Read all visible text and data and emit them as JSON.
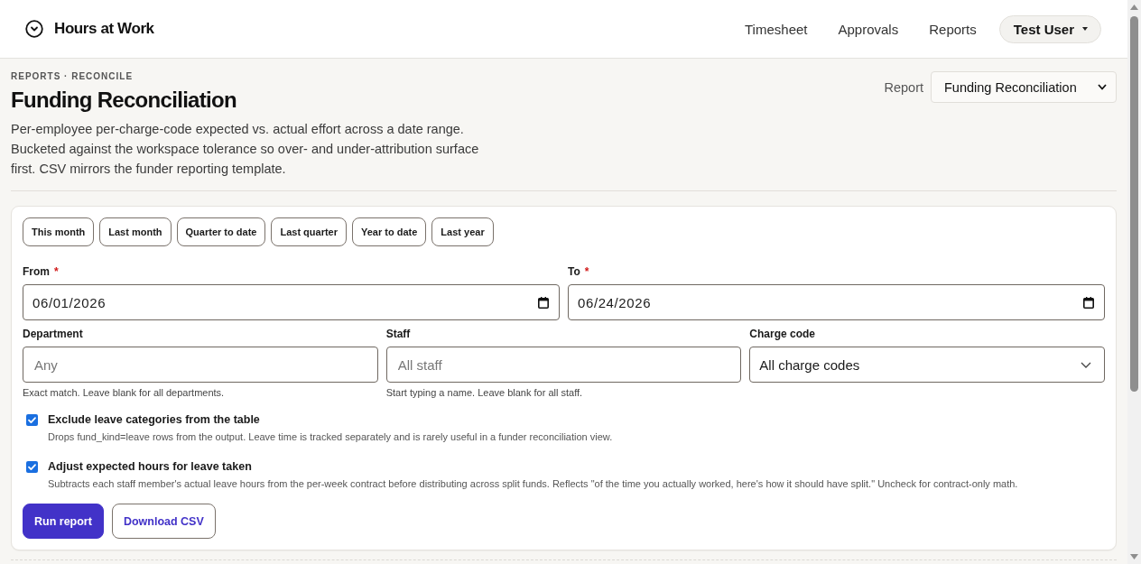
{
  "app": {
    "title": "Hours at Work"
  },
  "nav": {
    "links": [
      {
        "label": "Timesheet"
      },
      {
        "label": "Approvals"
      },
      {
        "label": "Reports"
      }
    ],
    "user_menu": {
      "label": "Test User"
    }
  },
  "page_header": {
    "breadcrumb": "REPORTS · RECONCILE",
    "title": "Funding Reconciliation",
    "description": "Per-employee per-charge-code expected vs. actual effort across a date range. Bucketed against the workspace tolerance so over- and under-attribution surface first. CSV mirrors the funder reporting template.",
    "report_picker": {
      "label": "Report",
      "value": "Funding Reconciliation"
    }
  },
  "filters": {
    "presets": [
      {
        "label": "This month"
      },
      {
        "label": "Last month"
      },
      {
        "label": "Quarter to date"
      },
      {
        "label": "Last quarter"
      },
      {
        "label": "Year to date"
      },
      {
        "label": "Last year"
      }
    ],
    "field_rows": [
      {
        "fields": [
          {
            "kind": "date",
            "label": "From",
            "required_mark": "*",
            "value": "06/01/2026"
          },
          {
            "kind": "date",
            "label": "To",
            "required_mark": "*",
            "value": "06/24/2026"
          }
        ]
      },
      {
        "fields": [
          {
            "kind": "text",
            "label": "Department",
            "placeholder": "Any",
            "hint": "Exact match. Leave blank for all departments."
          },
          {
            "kind": "text",
            "label": "Staff",
            "placeholder": "All staff",
            "hint": "Start typing a name. Leave blank for all staff."
          },
          {
            "kind": "select",
            "label": "Charge code",
            "value": "All charge codes"
          }
        ]
      }
    ],
    "options": [
      {
        "label": "Exclude leave categories from the table",
        "description": "Drops fund_kind=leave rows from the output. Leave time is tracked separately and is rarely useful in a funder reconciliation view.",
        "checked": true
      },
      {
        "label": "Adjust expected hours for leave taken",
        "description": "Subtracts each staff member's actual leave hours from the per-week contract before distributing across split funds. Reflects \"of the time you actually worked, here's how it should have split.\" Uncheck for contract-only math.",
        "checked": true
      }
    ],
    "actions": [
      {
        "kind": "primary",
        "label": "Run report"
      },
      {
        "kind": "secondary",
        "label": "Download CSV"
      }
    ]
  }
}
